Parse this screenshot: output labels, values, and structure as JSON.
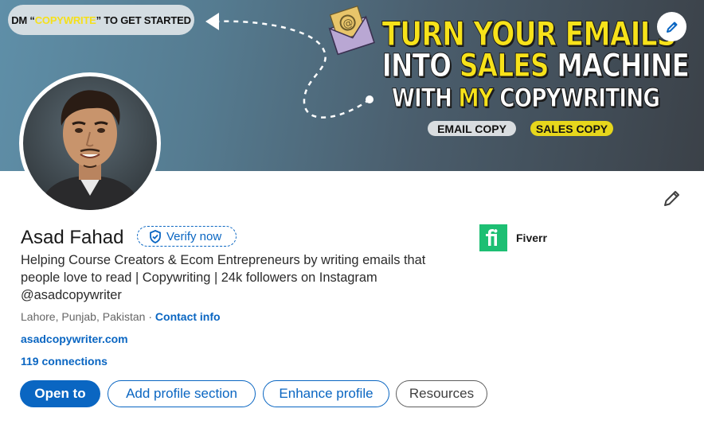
{
  "banner": {
    "cta_prefix": "DM “",
    "cta_keyword": "COPYWRITE",
    "cta_suffix": "” TO GET STARTED",
    "headline_line1": "TURN YOUR EMAILS",
    "headline_line2_a": "INTO ",
    "headline_line2_b": "SALES",
    "headline_line2_c": " MACHINE",
    "headline_line3_a": "WITH ",
    "headline_line3_b": "MY",
    "headline_line3_c": " COPYWRITING",
    "pill_email": "EMAIL COPY",
    "pill_sales": "SALES COPY",
    "edit_icon": "pencil-icon"
  },
  "profile": {
    "name": "Asad Fahad",
    "verify_label": "Verify now",
    "headline": "Helping Course Creators & Ecom Entrepreneurs by writing emails that people love to read | Copywriting | 24k followers on Instagram @asadcopywriter",
    "location": "Lahore, Punjab, Pakistan",
    "separator": " · ",
    "contact_info": "Contact info",
    "website": "asadcopywriter.com",
    "connections": "119 connections"
  },
  "organization": {
    "logo_text": "fi",
    "name": "Fiverr"
  },
  "actions": {
    "open_to": "Open to",
    "add_section": "Add profile section",
    "enhance": "Enhance profile",
    "resources": "Resources"
  },
  "colors": {
    "accent": "#0a66c2",
    "fiverr": "#1dbf73",
    "banner_yellow": "#f7e21a"
  }
}
